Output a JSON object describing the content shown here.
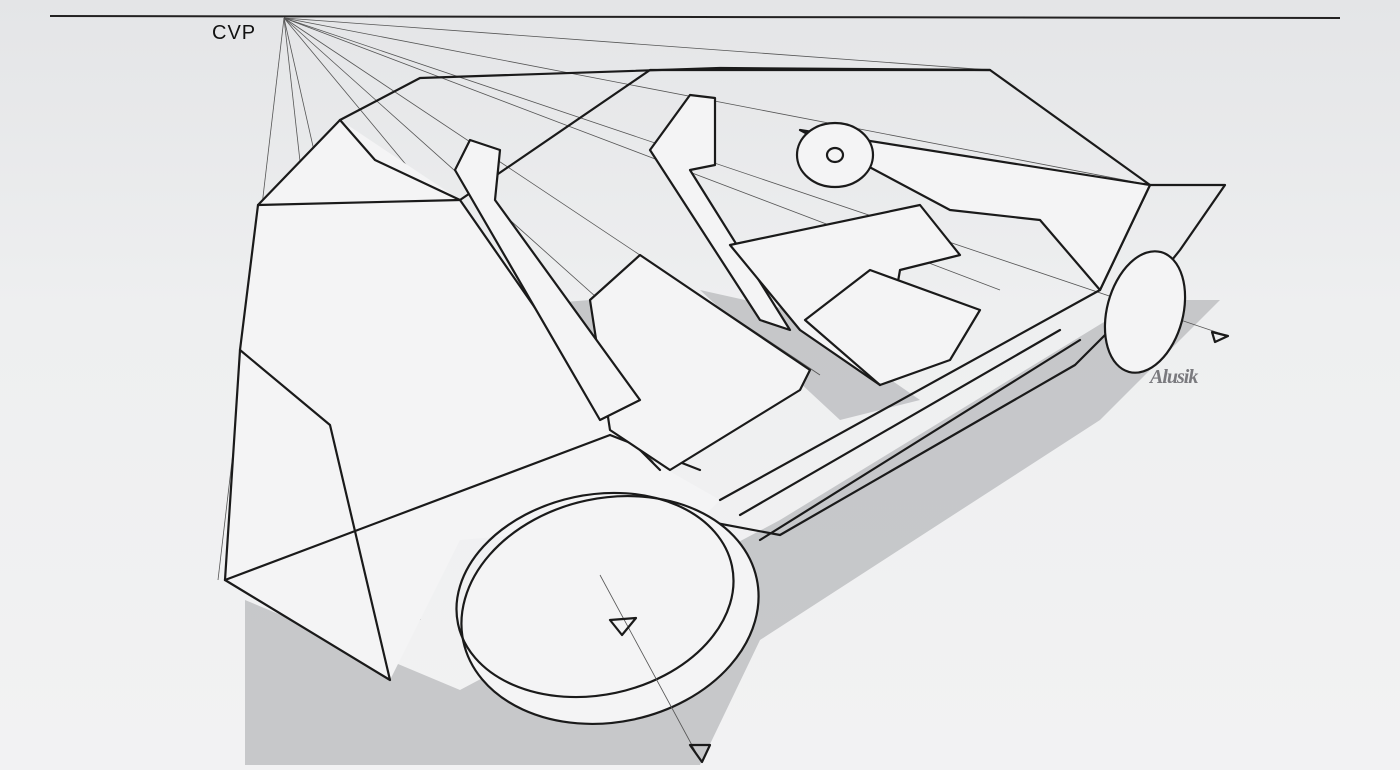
{
  "sketch": {
    "vanishing_point_label": "CVP",
    "signature": "Alusik"
  },
  "colors": {
    "paper": "#eeeff0",
    "ink": "#1a1a1a",
    "shadow": "#b8b9bc"
  }
}
